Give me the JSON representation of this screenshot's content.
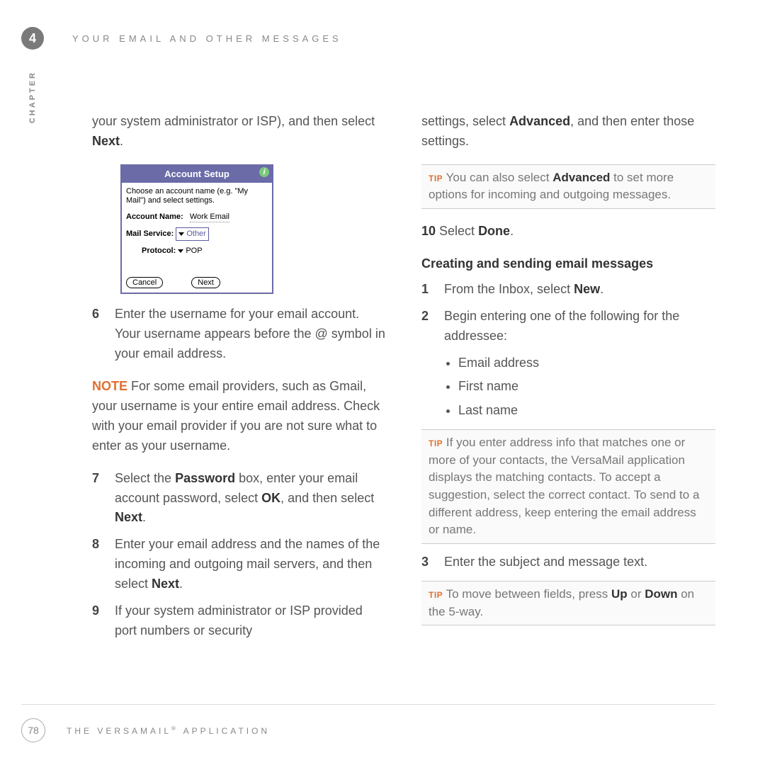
{
  "chapter_num": "4",
  "header_title": "YOUR EMAIL AND OTHER MESSAGES",
  "side_label": "CHAPTER",
  "page_num": "78",
  "footer_title_pre": "THE VERSAMAIL",
  "footer_title_post": " APPLICATION",
  "left": {
    "intro_pre": "your system administrator or ISP), and then select ",
    "intro_bold": "Next",
    "intro_post": ".",
    "shot": {
      "title": "Account Setup",
      "hint": "Choose an account name (e.g. \"My Mail\") and select settings.",
      "acct_lbl": "Account Name:",
      "acct_val": "Work Email",
      "service_lbl": "Mail Service:",
      "service_val": "Other",
      "proto_lbl": "Protocol:",
      "proto_val": "POP",
      "cancel": "Cancel",
      "next": "Next"
    },
    "step6_num": "6",
    "step6": "Enter the username for your email account. Your username appears before the @ symbol in your email address.",
    "note_label": "NOTE",
    "note_text": " For some email providers, such as Gmail, your username is your entire email address. Check with your email provider if you are not sure what to enter as your username.",
    "step7_num": "7",
    "step7_a": "Select the ",
    "step7_b": "Password",
    "step7_c": " box, enter your email account password, select ",
    "step7_d": "OK",
    "step7_e": ", and then select ",
    "step7_f": "Next",
    "step7_g": ".",
    "step8_num": "8",
    "step8_a": "Enter your email address and the names of the incoming and outgoing mail servers, and then select ",
    "step8_b": "Next",
    "step8_c": ".",
    "step9_num": "9",
    "step9": "If your system administrator or ISP provided port numbers or security"
  },
  "right": {
    "cont_a": "settings, select ",
    "cont_b": "Advanced",
    "cont_c": ", and then enter those settings.",
    "tip1_label": "TIP",
    "tip1_a": " You can also select ",
    "tip1_b": "Advanced",
    "tip1_c": " to set more options for incoming and outgoing messages.",
    "step10_num": "10",
    "step10_a": " Select ",
    "step10_b": "Done",
    "step10_c": ".",
    "section": "Creating and sending email messages",
    "s1_num": "1",
    "s1_a": "From the Inbox, select ",
    "s1_b": "New",
    "s1_c": ".",
    "s2_num": "2",
    "s2": "Begin entering one of the following for the addressee:",
    "b1": "Email address",
    "b2": "First name",
    "b3": "Last name",
    "tip2_label": "TIP",
    "tip2": " If you enter address info that matches one or more of your contacts, the VersaMail application displays the matching contacts. To accept a suggestion, select the correct contact. To send to a different address, keep entering the email address or name.",
    "s3_num": "3",
    "s3": "Enter the subject and message text.",
    "tip3_label": "TIP",
    "tip3_a": " To move between fields, press ",
    "tip3_b": "Up",
    "tip3_c": " or ",
    "tip3_d": "Down",
    "tip3_e": " on the 5-way."
  }
}
